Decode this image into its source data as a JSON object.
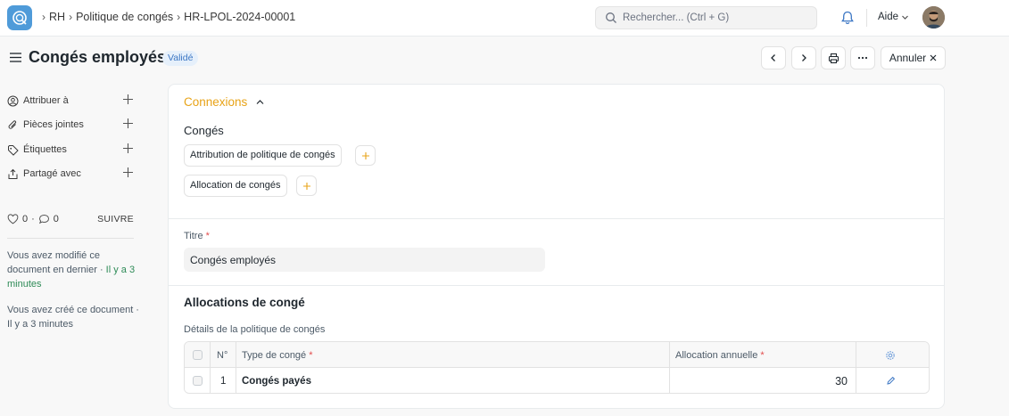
{
  "navbar": {
    "breadcrumbs": [
      "RH",
      "Politique de congés",
      "HR-LPOL-2024-00001"
    ],
    "search_placeholder": "Rechercher... (Ctrl + G)",
    "help_label": "Aide"
  },
  "page": {
    "title": "Congés employés",
    "status": "Validé",
    "cancel_label": "Annuler"
  },
  "sidebar": {
    "items": [
      {
        "label": "Attribuer à",
        "icon": "assign-user-icon"
      },
      {
        "label": "Pièces jointes",
        "icon": "paperclip-icon"
      },
      {
        "label": "Étiquettes",
        "icon": "tag-icon"
      },
      {
        "label": "Partagé avec",
        "icon": "share-icon"
      }
    ],
    "likes_count": "0",
    "comments_count": "0",
    "follow_label": "SUIVRE",
    "modified_text": "Vous avez modifié ce document en dernier · ",
    "modified_time": "Il y a 3 minutes",
    "created_text": "Vous avez créé ce document · Il y a 3 minutes"
  },
  "connections": {
    "title": "Connexions",
    "group": "Congés",
    "links": [
      "Attribution de politique de congés",
      "Allocation de congés"
    ]
  },
  "form": {
    "title_label": "Titre",
    "title_value": "Congés employés",
    "required_mark": "*",
    "allocations_section": "Allocations de congé",
    "details_label": "Détails de la politique de congés",
    "table": {
      "col_no": "N°",
      "col_type": "Type de congé",
      "col_alloc": "Allocation annuelle",
      "rows": [
        {
          "no": "1",
          "type": "Congés payés",
          "allocation": "30"
        }
      ]
    }
  },
  "colors": {
    "accent_orange": "#e8a317",
    "badge_blue": "#3b76c4",
    "required_red": "#e24c4c"
  }
}
